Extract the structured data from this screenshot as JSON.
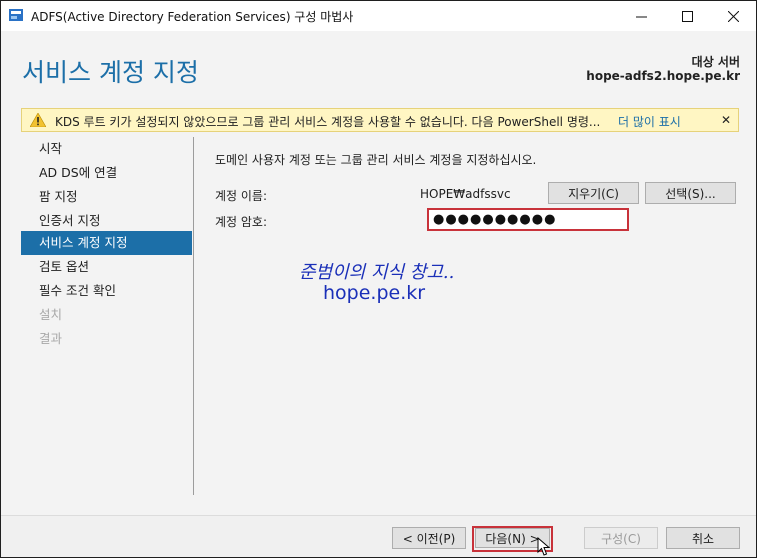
{
  "window": {
    "title": "ADFS(Active Directory Federation Services) 구성 마법사",
    "controls": {
      "minimize": "—",
      "maximize": "☐",
      "close": "✕"
    }
  },
  "header": {
    "page_title": "서비스 계정 지정",
    "target_label": "대상 서버",
    "target_server": "hope-adfs2.hope.pe.kr"
  },
  "warning": {
    "text": "KDS 루트 키가 설정되지 않았으므로 그룹 관리 서비스 계정을 사용할 수 없습니다. 다음 PowerShell 명령...",
    "more": "더 많이 표시",
    "close": "✕"
  },
  "sidebar": {
    "items": [
      {
        "label": "시작",
        "state": "normal"
      },
      {
        "label": "AD DS에 연결",
        "state": "normal"
      },
      {
        "label": "팜 지정",
        "state": "normal"
      },
      {
        "label": "인증서 지정",
        "state": "normal"
      },
      {
        "label": "서비스 계정 지정",
        "state": "active"
      },
      {
        "label": "검토 옵션",
        "state": "normal"
      },
      {
        "label": "필수 조건 확인",
        "state": "normal"
      },
      {
        "label": "설치",
        "state": "disabled"
      },
      {
        "label": "결과",
        "state": "disabled"
      }
    ]
  },
  "main": {
    "instruction": "도메인 사용자 계정 또는 그룹 관리 서비스 계정을 지정하십시오.",
    "account_name_label": "계정 이름:",
    "account_name_value": "HOPE₩adfssvc",
    "clear_button": "지우기(C)",
    "select_button": "선택(S)...",
    "password_label": "계정 암호:",
    "password_value": "●●●●●●●●●●"
  },
  "watermark": {
    "line1": "준범이의 지식 창고..",
    "line2": "hope.pe.kr"
  },
  "footer": {
    "prev": "< 이전(P)",
    "next": "다음(N) >",
    "configure": "구성(C)",
    "cancel": "취소"
  },
  "colors": {
    "accent": "#1c6fa8",
    "warning_bg": "#fff6c3",
    "highlight_border": "#c8323a",
    "watermark": "#1a2fb8"
  }
}
